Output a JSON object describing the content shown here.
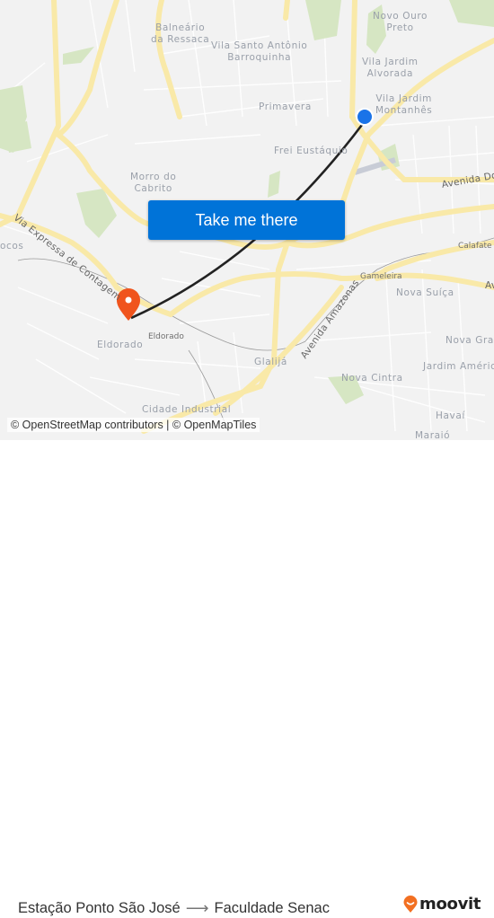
{
  "map": {
    "labels": [
      {
        "id": "balneario",
        "text": "Balneário\nda Ressaca"
      },
      {
        "id": "vila-santo-antonio",
        "text": "Vila Santo Antônio\nBarroquinha"
      },
      {
        "id": "novo-ouro-preto",
        "text": "Novo Ouro\nPreto"
      },
      {
        "id": "vila-jardim-alvorada",
        "text": "Vila Jardim\nAlvorada"
      },
      {
        "id": "vila-jardim-montanhes",
        "text": "Vila Jardim\nMontanhês"
      },
      {
        "id": "primavera",
        "text": "Primavera"
      },
      {
        "id": "frei-eustaquio",
        "text": "Frei Eustáquio"
      },
      {
        "id": "morro-do-cabrito",
        "text": "Morro do\nCabrito"
      },
      {
        "id": "avenida-do",
        "text": "Avenida Do"
      },
      {
        "id": "via-expressa",
        "text": "Via Expressa de Contagem"
      },
      {
        "id": "cocos",
        "text": "ocos"
      },
      {
        "id": "calafate",
        "text": "Calafate"
      },
      {
        "id": "gameleira",
        "text": "Gameleira"
      },
      {
        "id": "nova-suica",
        "text": "Nova Suíça"
      },
      {
        "id": "av-right",
        "text": "Av"
      },
      {
        "id": "nova-gran",
        "text": "Nova Gran"
      },
      {
        "id": "jardim-america",
        "text": "Jardim América"
      },
      {
        "id": "avenida-amazonas",
        "text": "Avenida Amazonas"
      },
      {
        "id": "nova-cintra",
        "text": "Nova Cintra"
      },
      {
        "id": "eldorado-1",
        "text": "Eldorado"
      },
      {
        "id": "eldorado-2",
        "text": "Eldorado"
      },
      {
        "id": "glalija",
        "text": "Glalijá"
      },
      {
        "id": "havai",
        "text": "Havaí"
      },
      {
        "id": "cidade-industrial",
        "text": "Cidade Industrial"
      },
      {
        "id": "maraio",
        "text": "Maraió"
      }
    ],
    "origin_marker_color": "#1a73e8",
    "destination_marker_color": "#f0541d",
    "route_line_color": "#222222",
    "road_color": "#f9e9a8",
    "park_color": "#d6e6c3"
  },
  "cta": {
    "label": "Take me there",
    "color": "#0073d8"
  },
  "attribution": "© OpenStreetMap contributors | © OpenMapTiles",
  "footer": {
    "origin": "Estação Ponto São José",
    "arrow": "⟶",
    "destination": "Faculdade Senac",
    "brand": "moovit",
    "brand_color": "#f26f21"
  }
}
